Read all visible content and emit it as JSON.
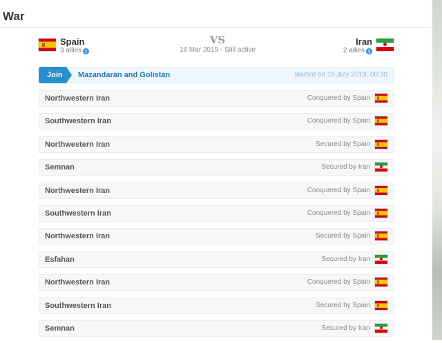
{
  "page": {
    "title": "War"
  },
  "war": {
    "vs_label": "VS",
    "date_status": "18 Mar 2019 - Still active",
    "attacker": {
      "name": "Spain",
      "allies": "3 allies",
      "flag": "spain"
    },
    "defender": {
      "name": "Iran",
      "allies": "2 allies",
      "flag": "iran"
    }
  },
  "battle": {
    "join_label": "Join",
    "region": "Mazandaran and Golistan",
    "started": "started on 19 July 2019, 00:30"
  },
  "regions": [
    {
      "name": "Northwestern Iran",
      "status": "Conquered by Spain",
      "flag": "spain"
    },
    {
      "name": "Southwestern Iran",
      "status": "Conquered by Spain",
      "flag": "spain"
    },
    {
      "name": "Northwestern Iran",
      "status": "Secured by Spain",
      "flag": "spain"
    },
    {
      "name": "Semnan",
      "status": "Secured by Iran",
      "flag": "iran"
    },
    {
      "name": "Northwestern Iran",
      "status": "Conquered by Spain",
      "flag": "spain"
    },
    {
      "name": "Southwestern Iran",
      "status": "Conquered by Spain",
      "flag": "spain"
    },
    {
      "name": "Northwestern Iran",
      "status": "Secured by Spain",
      "flag": "spain"
    },
    {
      "name": "Esfahan",
      "status": "Secured by Iran",
      "flag": "iran"
    },
    {
      "name": "Northwestern Iran",
      "status": "Conquered by Spain",
      "flag": "spain"
    },
    {
      "name": "Southwestern Iran",
      "status": "Secured by Spain",
      "flag": "spain"
    },
    {
      "name": "Semnan",
      "status": "Secured by Iran",
      "flag": "iran"
    }
  ],
  "colors": {
    "join": "#2a8fcf",
    "battle_link": "#2676b5",
    "info": "#3a8fd8"
  },
  "icons": {
    "info": "info-icon",
    "spain": "spain-flag-icon",
    "iran": "iran-flag-icon"
  }
}
